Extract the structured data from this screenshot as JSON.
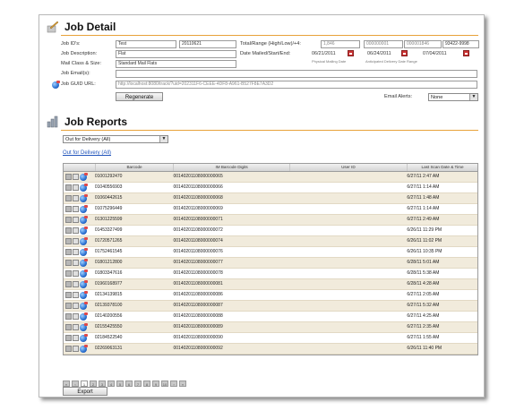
{
  "job_detail": {
    "title": "Job Detail",
    "labels": {
      "job_ids": "Job ID's:",
      "job_description": "Job Description:",
      "mail_class_size": "Mail Class & Size:",
      "job_emails": "Job Email(s):",
      "job_guid_url": "Job GUID URL:",
      "total_range": "Total/Range (High/Low)/+4:",
      "date_mailed": "Date Mailed/Start/End:",
      "email_alerts": "Email Alerts:"
    },
    "values": {
      "job_id_1": "Test",
      "job_id_2": "20110621",
      "description": "Flat",
      "mail_class": "Standard Mail Flats",
      "emails": "",
      "guid_url": "http://localhost:8080/track/?uid=202311F6-CEEE-4DF8-A961-B527F8E7A3D2",
      "total": "1,846",
      "range_low": "000000001",
      "range_high": "000001846",
      "plus4": "93422-9998",
      "date_mailed": "06/21/2011",
      "date_start": "06/24/2011",
      "date_end": "07/04/2011",
      "physical_mailing_date": "Physical Mailing Date",
      "anticipated_range": "Anticipated Delivery Date Range",
      "email_alerts": "None"
    },
    "regenerate_label": "Regenerate"
  },
  "job_reports": {
    "title": "Job Reports",
    "filter_selected": "Out for Delivery (All)",
    "filter_link": "Out for Delivery (All)",
    "columns": [
      "Barcode",
      "IM Barcode Digits",
      "User ID",
      "Last Scan Date & Time"
    ],
    "rows": [
      {
        "barcode": "01001292470",
        "im": "00140201108000000065",
        "user": "",
        "date": "6/27/11 2:47 AM"
      },
      {
        "barcode": "01040556903",
        "im": "00140201108000000066",
        "user": "",
        "date": "6/27/11 1:14 AM"
      },
      {
        "barcode": "01060442615",
        "im": "00140201108000000068",
        "user": "",
        "date": "6/27/11 1:48 AM"
      },
      {
        "barcode": "01075296449",
        "im": "00140201108000000069",
        "user": "",
        "date": "6/27/11 1:14 AM"
      },
      {
        "barcode": "01301225599",
        "im": "00140201108000000071",
        "user": "",
        "date": "6/27/11 2:49 AM"
      },
      {
        "barcode": "01453327499",
        "im": "00140201108000000072",
        "user": "",
        "date": "6/26/11 11:29 PM"
      },
      {
        "barcode": "01720571265",
        "im": "00140201108000000074",
        "user": "",
        "date": "6/26/11 11:02 PM"
      },
      {
        "barcode": "01752461545",
        "im": "00140201108000000076",
        "user": "",
        "date": "6/26/11 10:35 PM"
      },
      {
        "barcode": "01801212800",
        "im": "00140201108000000077",
        "user": "",
        "date": "6/28/11 5:01 AM"
      },
      {
        "barcode": "01803347616",
        "im": "00140201108000000078",
        "user": "",
        "date": "6/28/11 5:38 AM"
      },
      {
        "barcode": "01960168977",
        "im": "00140201108000000081",
        "user": "",
        "date": "6/28/11 4:28 AM"
      },
      {
        "barcode": "02134139815",
        "im": "00140201108000000086",
        "user": "",
        "date": "6/27/11 2:05 AM"
      },
      {
        "barcode": "02139378100",
        "im": "00140201108000000087",
        "user": "",
        "date": "6/27/11 5:32 AM"
      },
      {
        "barcode": "02140200556",
        "im": "00140201108000000088",
        "user": "",
        "date": "6/27/11 4:25 AM"
      },
      {
        "barcode": "02155425550",
        "im": "00140201108000000089",
        "user": "",
        "date": "6/27/11 2:35 AM"
      },
      {
        "barcode": "02184522540",
        "im": "00140201108000000090",
        "user": "",
        "date": "6/27/11 1:55 AM"
      },
      {
        "barcode": "02269063131",
        "im": "00140201108000000092",
        "user": "",
        "date": "6/26/11 11:40 PM"
      }
    ],
    "pager": [
      "«",
      "‹",
      "1",
      "2",
      "3",
      "4",
      "5",
      "6",
      "7",
      "8",
      "9",
      "10",
      "›",
      "»"
    ],
    "current_page": "1",
    "export_label": "Export"
  },
  "icons": {
    "row_doc": "document-icon",
    "row_map": "map-icon",
    "row_globe": "globe-icon"
  },
  "colors": {
    "accent_rule": "#e8a23a",
    "row_alt": "#f1ebdc",
    "link": "#2255bb"
  }
}
